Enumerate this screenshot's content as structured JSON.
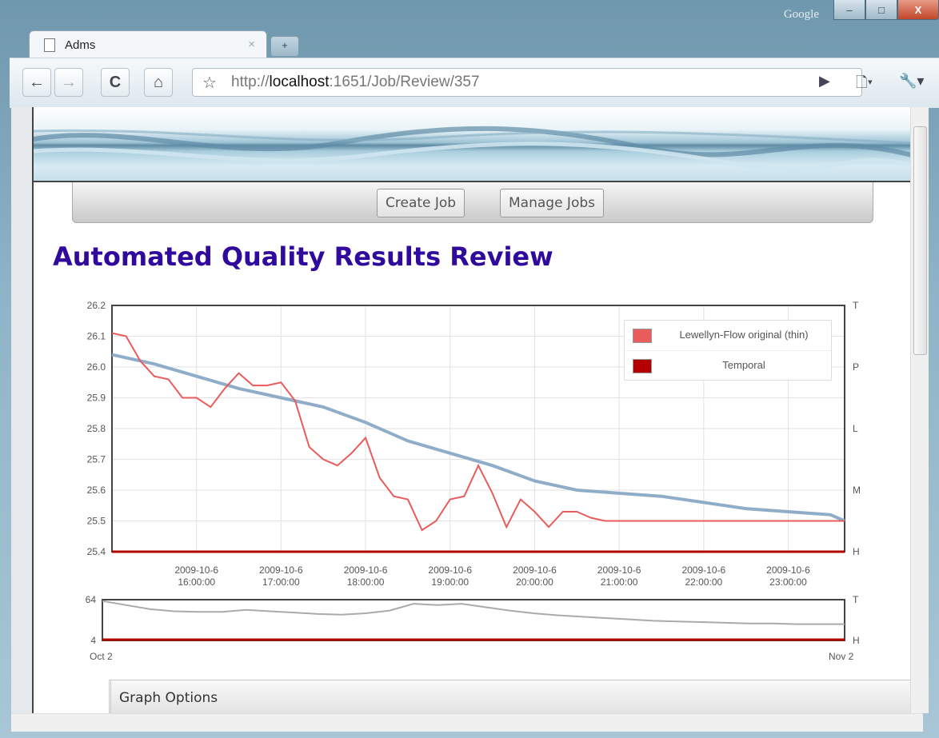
{
  "browser": {
    "google_label": "Google",
    "tab_title": "Adms",
    "tab_close": "×",
    "new_tab": "+",
    "url_prefix": "http://",
    "url_host": "localhost",
    "url_rest": ":1651/Job/Review/357",
    "window_buttons": {
      "minimize": "–",
      "maximize": "□",
      "close": "X"
    }
  },
  "nav": {
    "create_job": "Create Job",
    "manage_jobs": "Manage Jobs"
  },
  "page_title": "Automated Quality Results Review",
  "graph_options_label": "Graph Options",
  "colors": {
    "title": "#300a9c",
    "series_thin": "#e85c5c",
    "series_temporal": "#b30000",
    "smooth": "#8fadc9"
  },
  "chart_data": [
    {
      "type": "line",
      "ylim": [
        25.4,
        26.2
      ],
      "y_ticks": [
        "26.2",
        "26.1",
        "26.0",
        "25.9",
        "25.8",
        "25.7",
        "25.6",
        "25.5",
        "25.4"
      ],
      "right_axis_labels": [
        "T",
        "P",
        "L",
        "M",
        "H"
      ],
      "x_tick_labels": [
        [
          "2009-10-6",
          "16:00:00"
        ],
        [
          "2009-10-6",
          "17:00:00"
        ],
        [
          "2009-10-6",
          "18:00:00"
        ],
        [
          "2009-10-6",
          "19:00:00"
        ],
        [
          "2009-10-6",
          "20:00:00"
        ],
        [
          "2009-10-6",
          "21:00:00"
        ],
        [
          "2009-10-6",
          "22:00:00"
        ],
        [
          "2009-10-6",
          "23:00:00"
        ]
      ],
      "x_hours": [
        15.333,
        16.333,
        17.333,
        18.333,
        19.333,
        20.333,
        21.333,
        22.333,
        23.333,
        24.0
      ],
      "series": [
        {
          "name": "Lewellyn-Flow original (thin)",
          "color": "#e85c5c",
          "x": [
            15.333,
            15.5,
            15.667,
            15.833,
            16.0,
            16.167,
            16.333,
            16.5,
            16.667,
            16.833,
            17.0,
            17.167,
            17.333,
            17.5,
            17.667,
            17.833,
            18.0,
            18.167,
            18.333,
            18.5,
            18.667,
            18.833,
            19.0,
            19.167,
            19.333,
            19.5,
            19.667,
            19.833,
            20.0,
            20.167,
            20.333,
            20.5,
            20.667,
            20.833,
            21.0,
            21.167,
            21.333,
            21.5,
            21.667,
            21.833,
            22.0,
            22.167,
            22.333,
            22.5,
            22.667,
            22.833,
            23.0,
            23.167,
            23.333,
            23.5,
            23.667,
            23.833,
            24.0
          ],
          "y": [
            26.11,
            26.1,
            26.02,
            25.97,
            25.96,
            25.9,
            25.9,
            25.87,
            25.93,
            25.98,
            25.94,
            25.94,
            25.95,
            25.89,
            25.74,
            25.7,
            25.68,
            25.72,
            25.77,
            25.64,
            25.58,
            25.57,
            25.47,
            25.5,
            25.57,
            25.58,
            25.68,
            25.59,
            25.48,
            25.57,
            25.53,
            25.48,
            25.53,
            25.53,
            25.51,
            25.5,
            25.5,
            25.5,
            25.5,
            25.5,
            25.5,
            25.5,
            25.5,
            25.5,
            25.5,
            25.5,
            25.5,
            25.5,
            25.5,
            25.5,
            25.5,
            25.5,
            25.5
          ]
        },
        {
          "name": "Temporal",
          "color": "#b30000",
          "x": [
            15.333,
            24.0
          ],
          "y": [
            25.4,
            25.4
          ]
        }
      ],
      "smooth": {
        "color": "#8fadc9",
        "x": [
          15.333,
          15.833,
          16.333,
          16.833,
          17.333,
          17.833,
          18.333,
          18.833,
          19.333,
          19.833,
          20.333,
          20.833,
          21.333,
          21.833,
          22.333,
          22.833,
          23.333,
          23.833,
          24.0
        ],
        "y": [
          26.04,
          26.01,
          25.97,
          25.93,
          25.9,
          25.87,
          25.82,
          25.76,
          25.72,
          25.68,
          25.63,
          25.6,
          25.59,
          25.58,
          25.56,
          25.54,
          25.53,
          25.52,
          25.5
        ]
      },
      "legend": [
        "Lewellyn-Flow original (thin)",
        "Temporal"
      ]
    },
    {
      "type": "area",
      "ylim": [
        4,
        64
      ],
      "y_ticks": [
        "64",
        "4"
      ],
      "right_axis_labels": [
        "T",
        "H"
      ],
      "x_labels": [
        "Oct 2",
        "Nov 2"
      ],
      "series": [
        {
          "name": "overview",
          "color": "#aaaaaa",
          "x": [
            0,
            1,
            2,
            3,
            4,
            5,
            6,
            7,
            8,
            9,
            10,
            11,
            12,
            13,
            14,
            15,
            16,
            17,
            18,
            19,
            20,
            21,
            22,
            23,
            24,
            25,
            26,
            27,
            28,
            29,
            30,
            31
          ],
          "y": [
            62,
            56,
            50,
            47,
            46,
            46,
            49,
            47,
            45,
            43,
            42,
            44,
            48,
            58,
            56,
            58,
            53,
            48,
            44,
            41,
            39,
            37,
            35,
            33,
            32,
            31,
            30,
            29,
            29,
            28,
            28,
            28
          ]
        }
      ]
    }
  ]
}
